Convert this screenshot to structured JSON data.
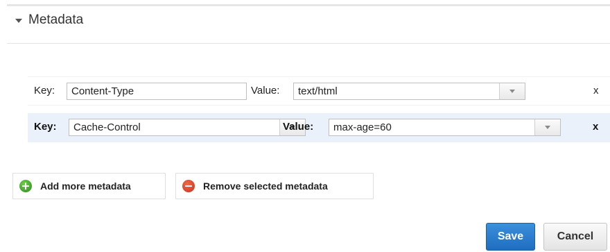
{
  "section": {
    "title": "Metadata",
    "toggle_icon": "caret-down-icon"
  },
  "rows": [
    {
      "key_label": "Key:",
      "key_value": "Content-Type",
      "value_label": "Value:",
      "value_value": "text/html",
      "remove_label": "x",
      "selected": false
    },
    {
      "key_label": "Key:",
      "key_value": "Cache-Control",
      "value_label": "Value:",
      "value_value": "max-age=60",
      "remove_label": "x",
      "selected": true
    }
  ],
  "actions": {
    "add_label": "Add more metadata",
    "add_icon": "add-circle-icon",
    "remove_label": "Remove selected metadata",
    "remove_icon": "remove-circle-icon"
  },
  "footer": {
    "save_label": "Save",
    "cancel_label": "Cancel"
  },
  "colors": {
    "selected_row_bg": "#eaf1fa",
    "save_bg": "#2a7fd4",
    "add_icon": "#3aa72a",
    "remove_icon": "#dd4226"
  }
}
